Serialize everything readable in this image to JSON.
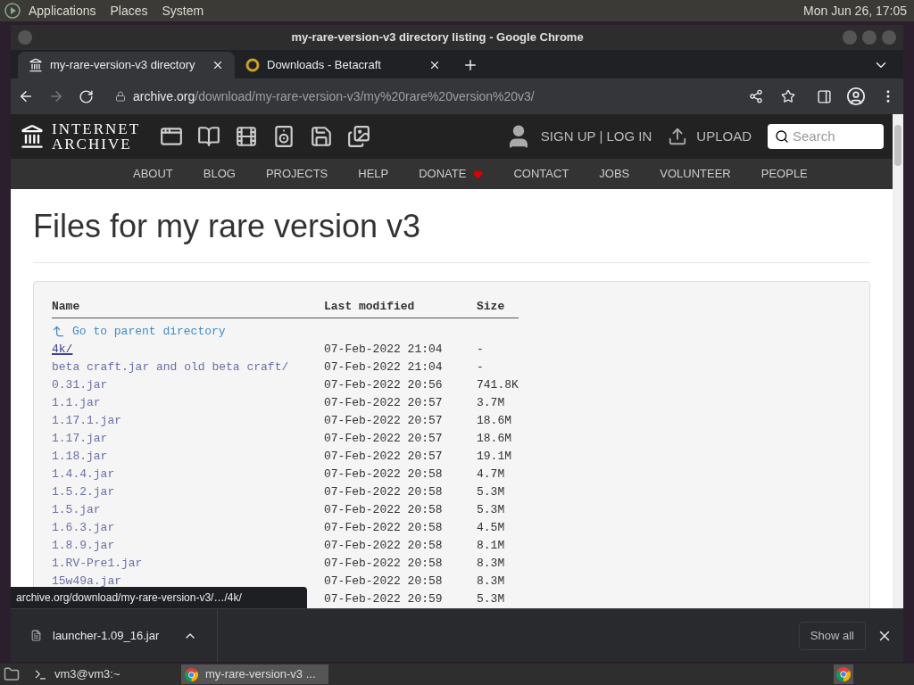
{
  "top_panel": {
    "menus": [
      "Applications",
      "Places",
      "System"
    ],
    "clock": "Mon Jun 26, 17:05"
  },
  "window": {
    "title": "my-rare-version-v3 directory listing - Google Chrome"
  },
  "tabs": [
    {
      "label": "my-rare-version-v3 directory",
      "selected": true
    },
    {
      "label": "Downloads - Betacraft",
      "selected": false
    }
  ],
  "address_bar": {
    "host": "archive.org",
    "path": "/download/my-rare-version-v3/my%20rare%20version%20v3/"
  },
  "site_header": {
    "logo_lines": [
      "INTERNET",
      "ARCHIVE"
    ],
    "account": "SIGN UP | LOG IN",
    "upload": "UPLOAD",
    "search": {
      "placeholder": "Search"
    }
  },
  "nav": [
    {
      "label": "ABOUT"
    },
    {
      "label": "BLOG"
    },
    {
      "label": "PROJECTS"
    },
    {
      "label": "HELP"
    },
    {
      "label": "DONATE",
      "kind": "heart"
    },
    {
      "label": "CONTACT"
    },
    {
      "label": "JOBS"
    },
    {
      "label": "VOLUNTEER"
    },
    {
      "label": "PEOPLE"
    }
  ],
  "page": {
    "title": "Files for my rare version v3"
  },
  "listing": {
    "columns": [
      "Name",
      "Last modified",
      "Size"
    ],
    "parent_link": "Go to parent directory",
    "rows": [
      {
        "name": "4k/",
        "modified": "07-Feb-2022 21:04",
        "size": "-",
        "hovered": true
      },
      {
        "name": "beta craft.jar and old beta craft/",
        "modified": "07-Feb-2022 21:04",
        "size": "-",
        "hovered": false
      },
      {
        "name": "0.31.jar",
        "modified": "07-Feb-2022 20:56",
        "size": "741.8K",
        "hovered": false
      },
      {
        "name": "1.1.jar",
        "modified": "07-Feb-2022 20:57",
        "size": "3.7M",
        "hovered": false
      },
      {
        "name": "1.17.1.jar",
        "modified": "07-Feb-2022 20:57",
        "size": "18.6M",
        "hovered": false
      },
      {
        "name": "1.17.jar",
        "modified": "07-Feb-2022 20:57",
        "size": "18.6M",
        "hovered": false
      },
      {
        "name": "1.18.jar",
        "modified": "07-Feb-2022 20:57",
        "size": "19.1M",
        "hovered": false
      },
      {
        "name": "1.4.4.jar",
        "modified": "07-Feb-2022 20:58",
        "size": "4.7M",
        "hovered": false
      },
      {
        "name": "1.5.2.jar",
        "modified": "07-Feb-2022 20:58",
        "size": "5.3M",
        "hovered": false
      },
      {
        "name": "1.5.jar",
        "modified": "07-Feb-2022 20:58",
        "size": "5.3M",
        "hovered": false
      },
      {
        "name": "1.6.3.jar",
        "modified": "07-Feb-2022 20:58",
        "size": "4.5M",
        "hovered": false
      },
      {
        "name": "1.8.9.jar",
        "modified": "07-Feb-2022 20:58",
        "size": "8.1M",
        "hovered": false
      },
      {
        "name": "1.RV-Pre1.jar",
        "modified": "07-Feb-2022 20:58",
        "size": "8.3M",
        "hovered": false
      },
      {
        "name": "15w49a.jar",
        "modified": "07-Feb-2022 20:58",
        "size": "8.3M",
        "hovered": false
      },
      {
        "modified": "07-Feb-2022 20:59",
        "size": "5.3M"
      }
    ]
  },
  "status_bubble": "archive.org/download/my-rare-version-v3/…/4k/",
  "download_bar": {
    "file": "launcher-1.09_16.jar",
    "show_all": "Show all"
  },
  "taskbar": [
    {
      "label": "vm3@vm3:~",
      "kind": "terminal",
      "selected": false
    },
    {
      "label": "my-rare-version-v3 ...",
      "kind": "browser",
      "selected": true
    }
  ]
}
